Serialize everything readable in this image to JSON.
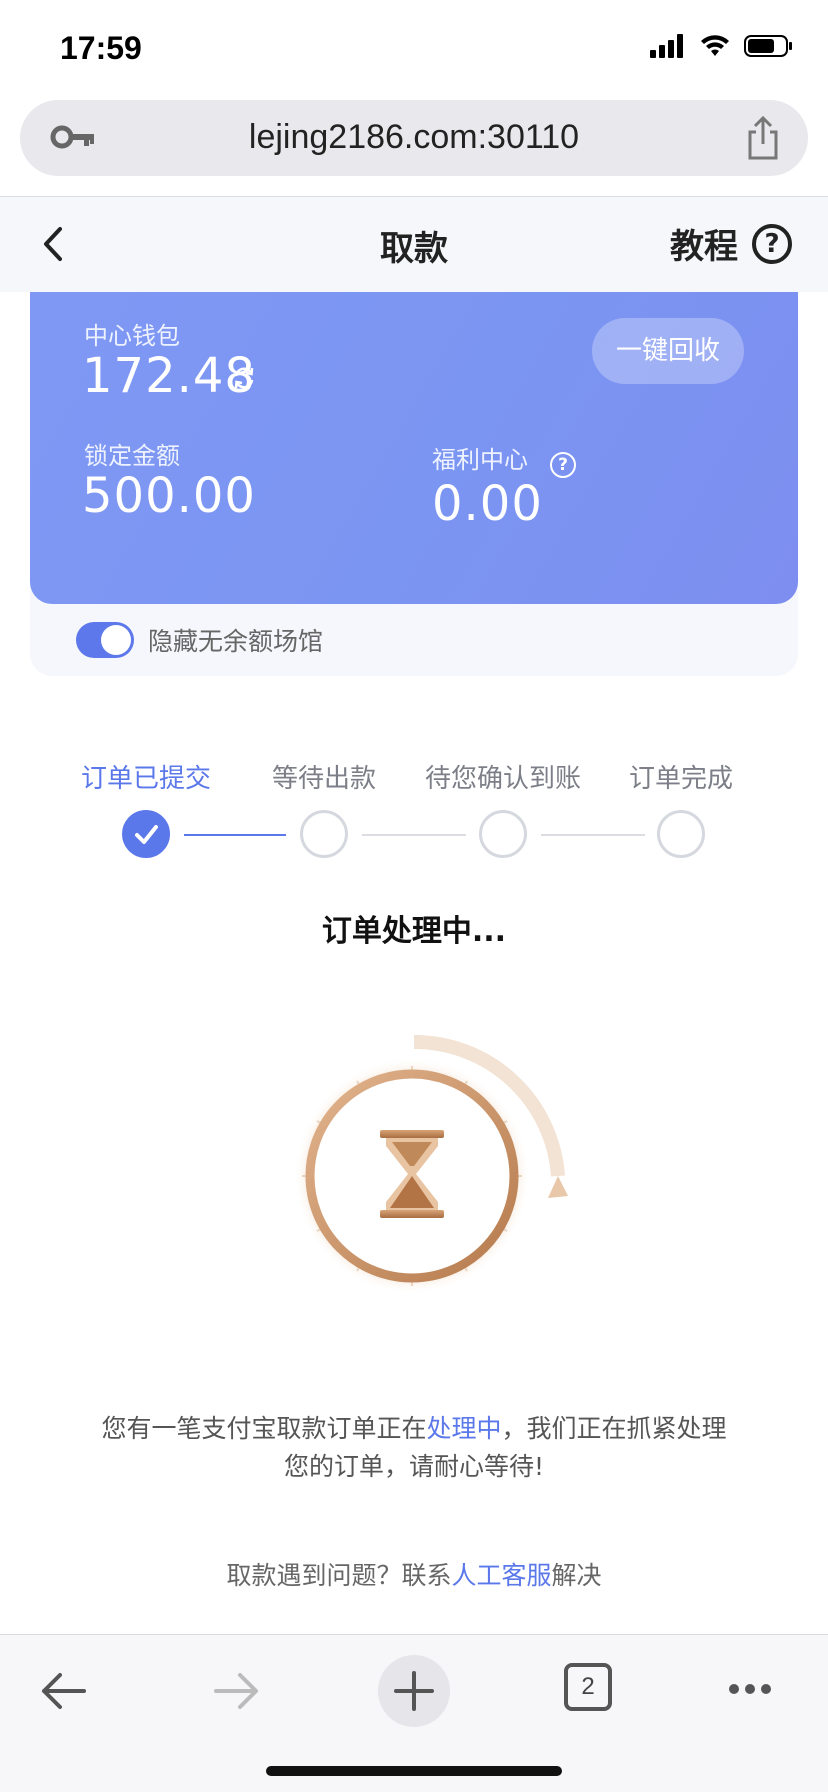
{
  "status": {
    "time": "17:59"
  },
  "browser": {
    "url": "lejing2186.com:30110"
  },
  "nav": {
    "title": "取款",
    "tutorial": "教程",
    "help": "?"
  },
  "wallet": {
    "center_label": "中心钱包",
    "center_value": "172.48",
    "recycle_button": "一键回收",
    "locked_label": "锁定金额",
    "locked_value": "500.00",
    "welfare_label": "福利中心",
    "welfare_value": "0.00",
    "welfare_help": "?",
    "hide_toggle_label": "隐藏无余额场馆",
    "hide_toggle_on": true
  },
  "steps": [
    {
      "label": "订单已提交",
      "state": "done"
    },
    {
      "label": "等待出款",
      "state": "pending"
    },
    {
      "label": "待您确认到账",
      "state": "pending"
    },
    {
      "label": "订单完成",
      "state": "pending"
    }
  ],
  "processing_title": "订单处理中...",
  "message": {
    "line1_a": "您有一笔支付宝取款订单正在",
    "line1_highlight": "处理中",
    "line1_b": "，我们正在抓紧处理",
    "line2": "您的订单，请耐心等待!"
  },
  "help_line": {
    "prefix": "取款遇到问题？联系",
    "link": "人工客服",
    "suffix": "解决"
  },
  "toolbar": {
    "tabs_count": "2"
  },
  "colors": {
    "accent": "#5b78ea",
    "card": "#7f98f4",
    "bronze": "#c89468"
  },
  "icons": [
    "key-icon",
    "share-icon",
    "back-arrow-icon",
    "help-circle-icon",
    "refresh-icon",
    "check-icon",
    "hourglass-icon",
    "back-icon",
    "forward-icon",
    "plus-icon",
    "tabs-icon",
    "more-icon"
  ]
}
